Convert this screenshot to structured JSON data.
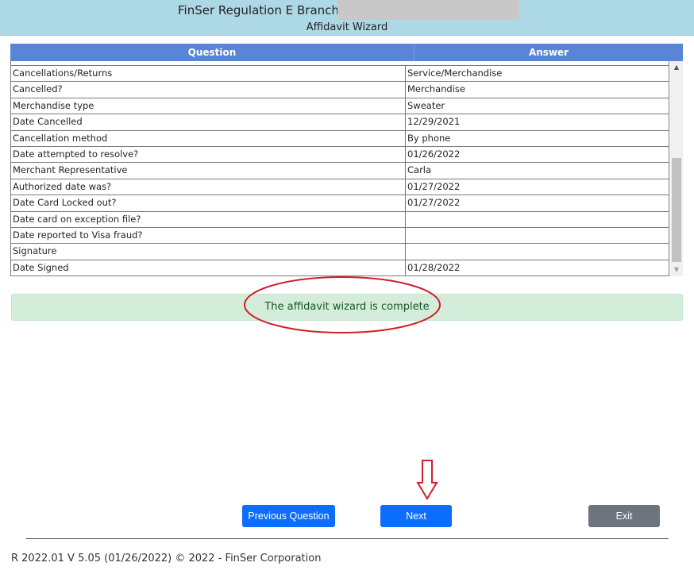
{
  "header": {
    "title": "FinSer Regulation E Branch -",
    "subtitle": "Affidavit Wizard"
  },
  "table": {
    "columns": [
      "Question",
      "Answer"
    ],
    "rows": [
      {
        "question": "Cancellations/Returns",
        "answer": "Service/Merchandise"
      },
      {
        "question": "Cancelled?",
        "answer": "Merchandise"
      },
      {
        "question": "Merchandise type",
        "answer": "Sweater"
      },
      {
        "question": "Date Cancelled",
        "answer": "12/29/2021"
      },
      {
        "question": "Cancellation method",
        "answer": "By phone"
      },
      {
        "question": "Date attempted to resolve?",
        "answer": "01/26/2022"
      },
      {
        "question": "Merchant Representative",
        "answer": "Carla"
      },
      {
        "question": "Authorized date was?",
        "answer": "01/27/2022"
      },
      {
        "question": "Date Card Locked out?",
        "answer": "01/27/2022"
      },
      {
        "question": "Date card on exception file?",
        "answer": ""
      },
      {
        "question": "Date reported to Visa fraud?",
        "answer": ""
      },
      {
        "question": "Signature",
        "answer": ""
      },
      {
        "question": "Date Signed",
        "answer": "01/28/2022"
      }
    ]
  },
  "alert": {
    "message": "The affidavit wizard is complete",
    "color": "#d4edda"
  },
  "buttons": {
    "previous": "Previous Question",
    "next": "Next",
    "exit": "Exit"
  },
  "footer": {
    "text": "R 2022.01 V 5.05 (01/26/2022) © 2022 - FinSer Corporation"
  },
  "colors": {
    "header_bg": "#add8e6",
    "table_header_bg": "#5a84d6",
    "primary": "#0d6efd",
    "secondary": "#6c757d",
    "annotation": "#d0202a"
  }
}
